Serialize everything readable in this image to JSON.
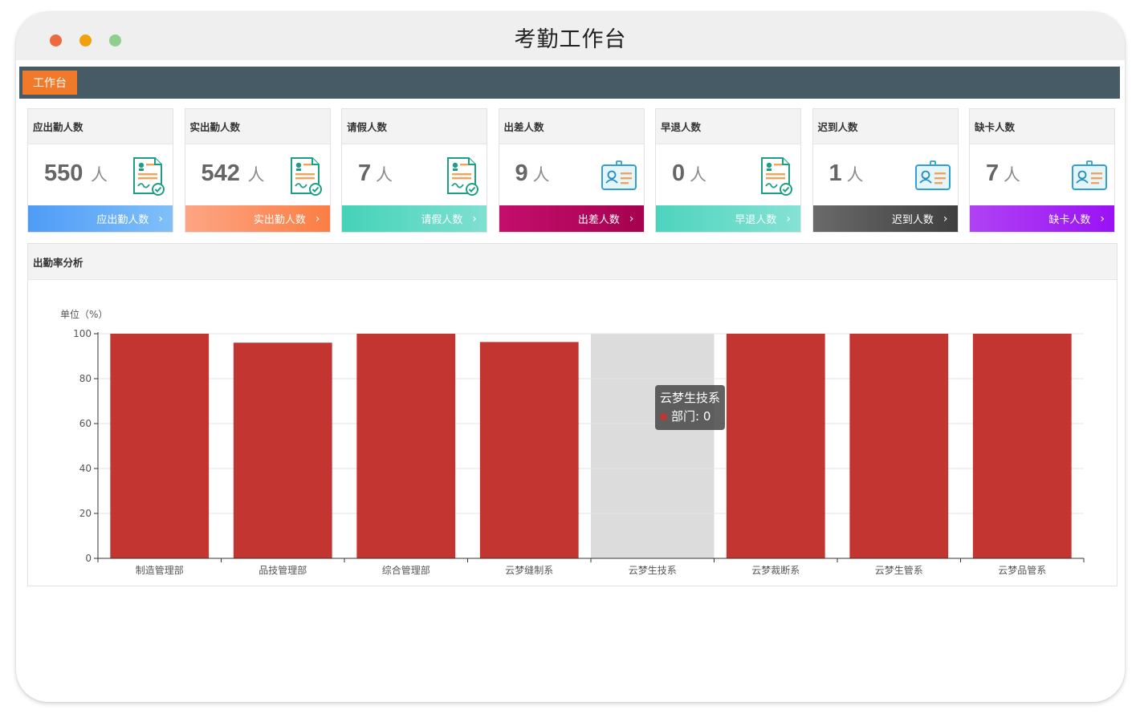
{
  "window": {
    "title": "考勤工作台"
  },
  "nav": {
    "tab_label": "工作台"
  },
  "cards": [
    {
      "title": "应出勤人数",
      "value": "550",
      "unit": "人",
      "link": "应出勤人数",
      "icon": "document-check-icon",
      "color_from": "#4f9cf7",
      "color_to": "#80c0f9"
    },
    {
      "title": "实出勤人数",
      "value": "542",
      "unit": "人",
      "link": "实出勤人数",
      "icon": "document-check-icon",
      "color_from": "#fda585",
      "color_to": "#fb7e43"
    },
    {
      "title": "请假人数",
      "value": "7",
      "unit": "人",
      "link": "请假人数",
      "icon": "document-check-icon",
      "color_from": "#44d2b8",
      "color_to": "#7fe0d1"
    },
    {
      "title": "出差人数",
      "value": "9",
      "unit": "人",
      "link": "出差人数",
      "icon": "id-card-icon",
      "color_from": "#c40e6d",
      "color_to": "#a5024f"
    },
    {
      "title": "早退人数",
      "value": "0",
      "unit": "人",
      "link": "早退人数",
      "icon": "document-check-icon",
      "color_from": "#4dd4be",
      "color_to": "#85e2d4"
    },
    {
      "title": "迟到人数",
      "value": "1",
      "unit": "人",
      "link": "迟到人数",
      "icon": "id-card-icon",
      "color_from": "#6a6a6a",
      "color_to": "#3f3f3f"
    },
    {
      "title": "缺卡人数",
      "value": "7",
      "unit": "人",
      "link": "缺卡人数",
      "icon": "id-card-icon",
      "color_from": "#b042f3",
      "color_to": "#9a12f5"
    }
  ],
  "panel": {
    "title": "出勤率分析"
  },
  "chart_data": {
    "type": "bar",
    "ylabel": "单位（%）",
    "ylim": [
      0,
      100
    ],
    "yticks": [
      0,
      20,
      40,
      60,
      80,
      100
    ],
    "categories": [
      "制造管理部",
      "品技管理部",
      "综合管理部",
      "云梦缝制系",
      "云梦生技系",
      "云梦裁断系",
      "云梦生管系",
      "云梦品管系"
    ],
    "values": [
      100,
      96,
      100,
      96.3,
      0,
      100,
      100,
      100
    ],
    "bar_color": "#c23531",
    "highlight_index": 4,
    "grid": true
  },
  "tooltip": {
    "title": "云梦生技系",
    "label": "部门: 0"
  }
}
